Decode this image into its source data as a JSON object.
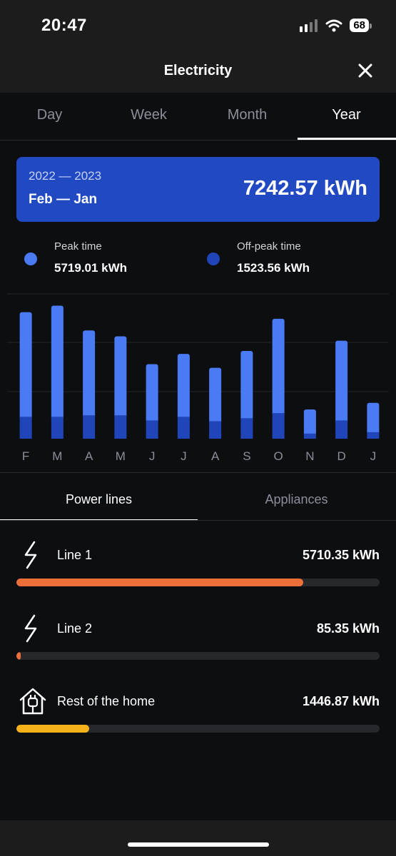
{
  "status": {
    "time": "20:47",
    "battery": "68"
  },
  "header": {
    "title": "Electricity"
  },
  "tabs": [
    {
      "label": "Day",
      "active": false
    },
    {
      "label": "Week",
      "active": false
    },
    {
      "label": "Month",
      "active": false
    },
    {
      "label": "Year",
      "active": true
    }
  ],
  "summary": {
    "years": "2022 — 2023",
    "months": "Feb — Jan",
    "total": "7242.57 kWh"
  },
  "legend": {
    "peak": {
      "label": "Peak time",
      "value": "5719.01 kWh",
      "color": "#4a7af4"
    },
    "offpeak": {
      "label": "Off-peak time",
      "value": "1523.56 kWh",
      "color": "#1f45b8"
    }
  },
  "chart_data": {
    "type": "bar",
    "stacked": true,
    "categories": [
      "F",
      "M",
      "A",
      "M",
      "J",
      "J",
      "A",
      "S",
      "O",
      "N",
      "D",
      "J"
    ],
    "series": [
      {
        "name": "Off-peak time",
        "color": "#1f45b8",
        "values": [
          30,
          30,
          32,
          32,
          25,
          30,
          24,
          28,
          35,
          7,
          25,
          9
        ]
      },
      {
        "name": "Peak time",
        "color": "#4a7af4",
        "values": [
          143,
          152,
          116,
          108,
          77,
          86,
          73,
          92,
          129,
          33,
          109,
          40
        ]
      }
    ],
    "ylim": [
      0,
      200
    ],
    "grid": true
  },
  "subtabs": [
    {
      "label": "Power lines",
      "active": true
    },
    {
      "label": "Appliances",
      "active": false
    }
  ],
  "lines": [
    {
      "name": "Line 1",
      "value": "5710.35 kWh",
      "fraction": 0.79,
      "color": "#ec6f3a",
      "icon": "lightning-icon"
    },
    {
      "name": "Line 2",
      "value": "85.35 kWh",
      "fraction": 0.012,
      "color": "#ec6f3a",
      "icon": "lightning-icon"
    },
    {
      "name": "Rest of the home",
      "value": "1446.87 kWh",
      "fraction": 0.2,
      "color": "#f6b21a",
      "icon": "house-plug-icon"
    }
  ]
}
